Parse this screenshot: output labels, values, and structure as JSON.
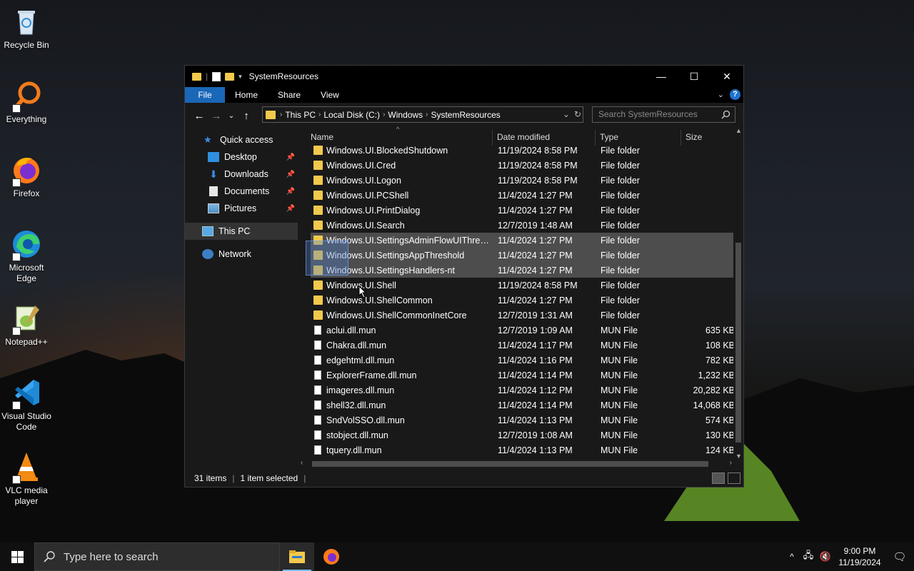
{
  "desktop": {
    "icons": [
      {
        "label": "Recycle Bin"
      },
      {
        "label": "Everything"
      },
      {
        "label": "Firefox"
      },
      {
        "label": "Microsoft Edge"
      },
      {
        "label": "Notepad++"
      },
      {
        "label": "Visual Studio Code"
      },
      {
        "label": "VLC media player"
      }
    ]
  },
  "window": {
    "title": "SystemResources",
    "ribbon_tabs": [
      "File",
      "Home",
      "Share",
      "View"
    ],
    "breadcrumbs": [
      "This PC",
      "Local Disk (C:)",
      "Windows",
      "SystemResources"
    ],
    "search_placeholder": "Search SystemResources",
    "nav": {
      "quick_access": "Quick access",
      "items": [
        "Desktop",
        "Downloads",
        "Documents",
        "Pictures"
      ],
      "this_pc": "This PC",
      "network": "Network"
    },
    "columns": {
      "name": "Name",
      "date": "Date modified",
      "type": "Type",
      "size": "Size"
    },
    "rows": [
      {
        "name": "Windows.UI.BlockedShutdown",
        "date": "11/19/2024 8:58 PM",
        "type": "File folder",
        "size": "",
        "kind": "folder",
        "selected": false
      },
      {
        "name": "Windows.UI.Cred",
        "date": "11/19/2024 8:58 PM",
        "type": "File folder",
        "size": "",
        "kind": "folder",
        "selected": false
      },
      {
        "name": "Windows.UI.Logon",
        "date": "11/19/2024 8:58 PM",
        "type": "File folder",
        "size": "",
        "kind": "folder",
        "selected": false
      },
      {
        "name": "Windows.UI.PCShell",
        "date": "11/4/2024 1:27 PM",
        "type": "File folder",
        "size": "",
        "kind": "folder",
        "selected": false
      },
      {
        "name": "Windows.UI.PrintDialog",
        "date": "11/4/2024 1:27 PM",
        "type": "File folder",
        "size": "",
        "kind": "folder",
        "selected": false
      },
      {
        "name": "Windows.UI.Search",
        "date": "12/7/2019 1:48 AM",
        "type": "File folder",
        "size": "",
        "kind": "folder",
        "selected": false
      },
      {
        "name": "Windows.UI.SettingsAdminFlowUIThresh...",
        "date": "11/4/2024 1:27 PM",
        "type": "File folder",
        "size": "",
        "kind": "folder",
        "selected": true
      },
      {
        "name": "Windows.UI.SettingsAppThreshold",
        "date": "11/4/2024 1:27 PM",
        "type": "File folder",
        "size": "",
        "kind": "folder",
        "selected": true
      },
      {
        "name": "Windows.UI.SettingsHandlers-nt",
        "date": "11/4/2024 1:27 PM",
        "type": "File folder",
        "size": "",
        "kind": "folder",
        "selected": true
      },
      {
        "name": "Windows.UI.Shell",
        "date": "11/19/2024 8:58 PM",
        "type": "File folder",
        "size": "",
        "kind": "folder",
        "selected": false
      },
      {
        "name": "Windows.UI.ShellCommon",
        "date": "11/4/2024 1:27 PM",
        "type": "File folder",
        "size": "",
        "kind": "folder",
        "selected": false
      },
      {
        "name": "Windows.UI.ShellCommonInetCore",
        "date": "12/7/2019 1:31 AM",
        "type": "File folder",
        "size": "",
        "kind": "folder",
        "selected": false
      },
      {
        "name": "aclui.dll.mun",
        "date": "12/7/2019 1:09 AM",
        "type": "MUN File",
        "size": "635 KB",
        "kind": "file",
        "selected": false
      },
      {
        "name": "Chakra.dll.mun",
        "date": "11/4/2024 1:17 PM",
        "type": "MUN File",
        "size": "108 KB",
        "kind": "file",
        "selected": false
      },
      {
        "name": "edgehtml.dll.mun",
        "date": "11/4/2024 1:16 PM",
        "type": "MUN File",
        "size": "782 KB",
        "kind": "file",
        "selected": false
      },
      {
        "name": "ExplorerFrame.dll.mun",
        "date": "11/4/2024 1:14 PM",
        "type": "MUN File",
        "size": "1,232 KB",
        "kind": "file",
        "selected": false
      },
      {
        "name": "imageres.dll.mun",
        "date": "11/4/2024 1:12 PM",
        "type": "MUN File",
        "size": "20,282 KB",
        "kind": "file",
        "selected": false
      },
      {
        "name": "shell32.dll.mun",
        "date": "11/4/2024 1:14 PM",
        "type": "MUN File",
        "size": "14,068 KB",
        "kind": "file",
        "selected": false
      },
      {
        "name": "SndVolSSO.dll.mun",
        "date": "11/4/2024 1:13 PM",
        "type": "MUN File",
        "size": "574 KB",
        "kind": "file",
        "selected": false
      },
      {
        "name": "stobject.dll.mun",
        "date": "12/7/2019 1:08 AM",
        "type": "MUN File",
        "size": "130 KB",
        "kind": "file",
        "selected": false
      },
      {
        "name": "tquery.dll.mun",
        "date": "11/4/2024 1:13 PM",
        "type": "MUN File",
        "size": "124 KB",
        "kind": "file",
        "selected": false
      }
    ],
    "status": {
      "count": "31 items",
      "selection": "1 item selected"
    }
  },
  "taskbar": {
    "search_placeholder": "Type here to search",
    "time": "9:00 PM",
    "date": "11/19/2024"
  },
  "colors": {
    "accent": "#1a67b8",
    "folder": "#f2c94c",
    "selection": "#4d4d4d"
  }
}
